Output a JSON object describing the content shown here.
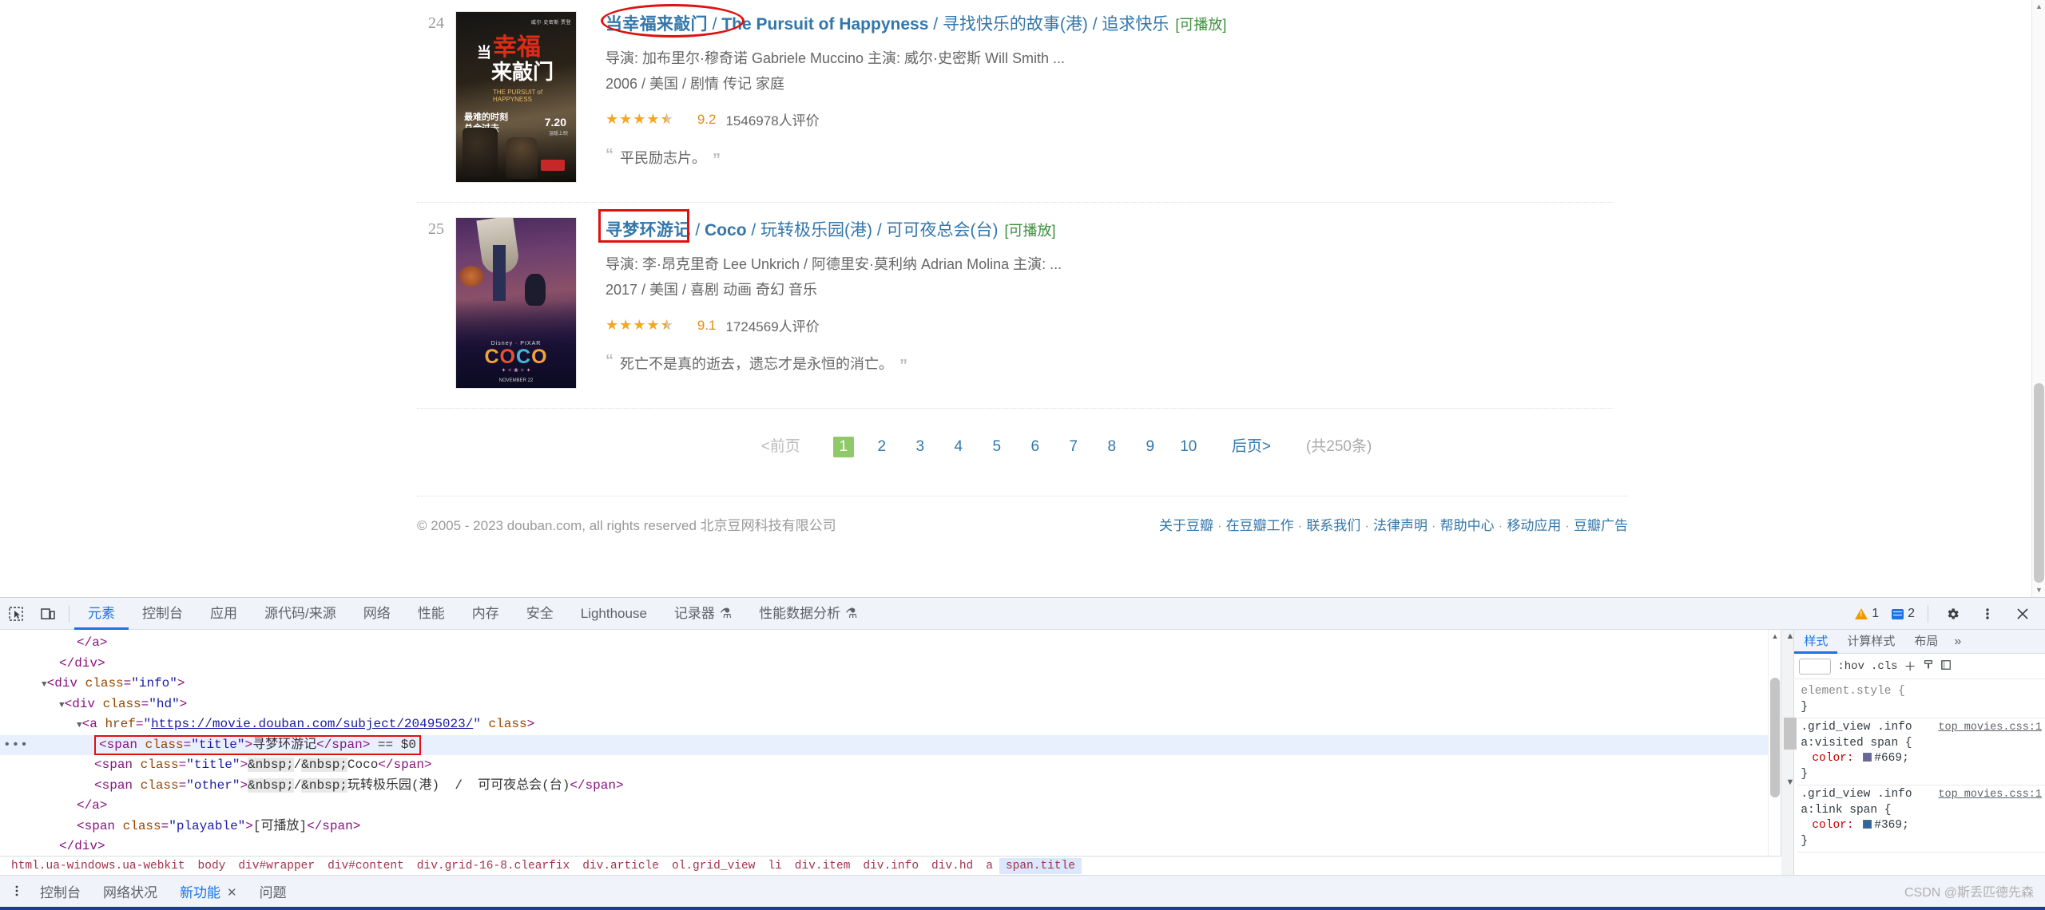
{
  "page": {
    "movies": [
      {
        "rank": "24",
        "title": "当幸福来敲门",
        "sep1": " / ",
        "title_alt": "The Pursuit of Happyness",
        "others": " / 寻找快乐的故事(港) / 追求快乐",
        "playable": "[可播放]",
        "credits": "导演: 加布里尔·穆奇诺 Gabriele Muccino   主演: 威尔·史密斯 Will Smith ...",
        "details": "2006 / 美国 / 剧情 传记 家庭",
        "stars": "★★★★",
        "half_star": "★",
        "rating": "9.2",
        "rating_count": "1546978人评价",
        "quote": "平民励志片。",
        "poster_alt": "当幸福来敲门 海报"
      },
      {
        "rank": "25",
        "title": "寻梦环游记",
        "sep1": " / ",
        "title_alt": "Coco",
        "others": " / 玩转极乐园(港) / 可可夜总会(台)",
        "playable": "[可播放]",
        "credits": "导演: 李·昂克里奇 Lee Unkrich / 阿德里安·莫利纳 Adrian Molina   主演: ...",
        "details": "2017 / 美国 / 喜剧 动画 奇幻 音乐",
        "stars": "★★★★",
        "half_star": "★",
        "rating": "9.1",
        "rating_count": "1724569人评价",
        "quote": "死亡不是真的逝去，遗忘才是永恒的消亡。",
        "poster_alt": "寻梦环游记 COCO 海报"
      }
    ],
    "paginator": {
      "prev": "<前页",
      "pages": [
        "1",
        "2",
        "3",
        "4",
        "5",
        "6",
        "7",
        "8",
        "9",
        "10"
      ],
      "current": "1",
      "next": "后页>",
      "total": "(共250条)"
    },
    "footer": {
      "copyright": "© 2005 - 2023 douban.com, all rights reserved 北京豆网科技有限公司",
      "links": [
        "关于豆瓣",
        "在豆瓣工作",
        "联系我们",
        "法律声明",
        "帮助中心",
        "移动应用",
        "豆瓣广告"
      ],
      "separator": "·"
    }
  },
  "devtools": {
    "toolbar": {
      "inspect_icon": "inspect-element-icon",
      "device_icon": "device-toolbar-icon",
      "tabs": [
        {
          "label": "元素",
          "active": true
        },
        {
          "label": "控制台",
          "active": false
        },
        {
          "label": "应用",
          "active": false
        },
        {
          "label": "源代码/来源",
          "active": false
        },
        {
          "label": "网络",
          "active": false
        },
        {
          "label": "性能",
          "active": false
        },
        {
          "label": "内存",
          "active": false
        },
        {
          "label": "安全",
          "active": false
        },
        {
          "label": "Lighthouse",
          "active": false
        },
        {
          "label": "记录器",
          "active": false,
          "flask": "⚗"
        },
        {
          "label": "性能数据分析",
          "active": false,
          "flask": "⚗"
        }
      ],
      "warnings": "1",
      "messages": "2",
      "settings_icon": "gear-icon",
      "more_icon": "kebab-menu-icon",
      "close_icon": "close-icon"
    },
    "dom": {
      "lines": [
        {
          "indent": 4,
          "html": "<span class='punc'>&lt;/a&gt;</span>"
        },
        {
          "indent": 3,
          "html": "<span class='punc'>&lt;/div&gt;</span>"
        },
        {
          "indent": 2,
          "html": "<span class='twisty'>▼</span><span class='punc'>&lt;</span><span class='tag'>div</span> <span class='attr'>class</span>=<span class='val'>\"info\"</span><span class='punc'>&gt;</span>"
        },
        {
          "indent": 3,
          "html": "<span class='twisty'>▼</span><span class='punc'>&lt;</span><span class='tag'>div</span> <span class='attr'>class</span>=<span class='val'>\"hd\"</span><span class='punc'>&gt;</span>"
        },
        {
          "indent": 4,
          "html": "<span class='twisty'>▼</span><span class='punc'>&lt;</span><span class='tag'>a</span> <span class='attr'>href</span>=<span class='val'>\"</span><span class='lnk'>https://movie.douban.com/subject/20495023/</span><span class='val'>\"</span> <span class='attr'>class</span><span class='punc'>&gt;</span>"
        },
        {
          "indent": 5,
          "selected": true,
          "boxed": true,
          "html": "<span class='punc'>&lt;</span><span class='tag'>span</span> <span class='attr'>class</span>=<span class='val'>\"title\"</span><span class='punc'>&gt;</span><span class='txt'>寻梦环游记</span><span class='punc'>&lt;/</span><span class='tag'>span</span><span class='punc'>&gt;</span> <span class='dollar'>== $0</span>"
        },
        {
          "indent": 5,
          "html": "<span class='punc'>&lt;</span><span class='tag'>span</span> <span class='attr'>class</span>=<span class='val'>\"title\"</span><span class='punc'>&gt;</span><span class='ent'>&amp;nbsp;</span><span class='txt'>/</span><span class='ent'>&amp;nbsp;</span><span class='txt'>Coco</span><span class='punc'>&lt;/</span><span class='tag'>span</span><span class='punc'>&gt;</span>"
        },
        {
          "indent": 5,
          "html": "<span class='punc'>&lt;</span><span class='tag'>span</span> <span class='attr'>class</span>=<span class='val'>\"other\"</span><span class='punc'>&gt;</span><span class='ent'>&amp;nbsp;</span><span class='txt'>/</span><span class='ent'>&amp;nbsp;</span><span class='txt'>玩转极乐园(港)&nbsp; / &nbsp;可可夜总会(台)</span><span class='punc'>&lt;/</span><span class='tag'>span</span><span class='punc'>&gt;</span>"
        },
        {
          "indent": 4,
          "html": "<span class='punc'>&lt;/a&gt;</span>"
        },
        {
          "indent": 4,
          "html": "<span class='punc'>&lt;</span><span class='tag'>span</span> <span class='attr'>class</span>=<span class='val'>\"playable\"</span><span class='punc'>&gt;</span><span class='txt'>[可播放]</span><span class='punc'>&lt;/</span><span class='tag'>span</span><span class='punc'>&gt;</span>"
        },
        {
          "indent": 3,
          "html": "<span class='punc'>&lt;/div&gt;</span>"
        },
        {
          "indent": 3,
          "html": "<span class='punc'>&lt;/div&gt;</span>"
        }
      ]
    },
    "breadcrumbs": [
      "html.ua-windows.ua-webkit",
      "body",
      "div#wrapper",
      "div#content",
      "div.grid-16-8.clearfix",
      "div.article",
      "ol.grid_view",
      "li",
      "div.item",
      "div.info",
      "div.hd",
      "a",
      "span.title"
    ],
    "breadcrumb_active": "span.title",
    "styles": {
      "tabs": [
        {
          "label": "样式",
          "active": true
        },
        {
          "label": "计算样式",
          "active": false
        },
        {
          "label": "布局",
          "active": false
        }
      ],
      "more": "»",
      "hov": ":hov",
      "cls": ".cls",
      "add_rule_icon": "add-style-rule-icon",
      "class_icon": "element-classes-icon",
      "sidebar_icon": "toggle-sidebar-icon",
      "rules": [
        {
          "selector": "element.style {",
          "source": "",
          "declarations": [],
          "close": "}"
        },
        {
          "selector": ".grid_view .info a:visited span {",
          "source": "top_movies.css:1",
          "declarations": [
            {
              "prop": "color:",
              "swatch": "#666699",
              "value": "#669;"
            }
          ],
          "close": "}"
        },
        {
          "selector": ".grid_view .info a:link span {",
          "source": "top_movies.css:1",
          "declarations": [
            {
              "prop": "color:",
              "swatch": "#336699",
              "value": "#369;"
            }
          ],
          "close": "}"
        }
      ]
    },
    "drawer": {
      "more_icon": "kebab-menu-icon",
      "tabs": [
        {
          "label": "控制台",
          "active": false,
          "closable": false
        },
        {
          "label": "网络状况",
          "active": false,
          "closable": false
        },
        {
          "label": "新功能",
          "active": true,
          "closable": true
        },
        {
          "label": "问题",
          "active": false,
          "closable": false
        }
      ]
    }
  },
  "watermark": "CSDN @斯丢匹德先森",
  "colors": {
    "link_blue": "#37a",
    "playable_green": "#3a8f3a",
    "annotation_red": "#e01010",
    "devtools_accent": "#1a73e8",
    "pagination_green": "#8fc96a"
  }
}
